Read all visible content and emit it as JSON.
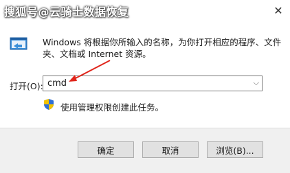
{
  "watermark": "搜狐号@云骑士数据恢复",
  "title_bar": {
    "close_glyph": "✕"
  },
  "description": "Windows 将根据你所输入的名称，为你打开相应的程序、文件夹、文档或 Internet 资源。",
  "open": {
    "label": "打开(O):",
    "value": "cmd"
  },
  "admin_note": "使用管理权限创建此任务。",
  "buttons": {
    "ok": "确定",
    "cancel": "取消",
    "browse": "浏览(B)..."
  },
  "colors": {
    "annotation_arrow": "#e0251b",
    "shield_blue": "#2f6fd6",
    "shield_yellow": "#f3c300"
  }
}
